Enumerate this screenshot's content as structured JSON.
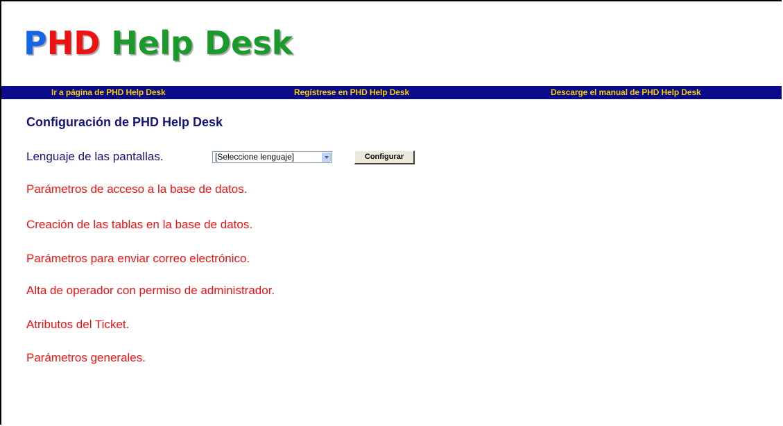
{
  "logo": {
    "p": "P",
    "hd": "HD",
    "rest": " Help Desk"
  },
  "nav": {
    "links": [
      "Ir a página de PHD Help Desk",
      "Regístrese en PHD Help Desk",
      "Descarge el manual de PHD Help Desk"
    ]
  },
  "page": {
    "title": "Configuración de PHD Help Desk"
  },
  "language": {
    "label": "Lenguaje de las pantallas.",
    "selected": "[Seleccione lenguaje]",
    "button_label": "Configurar"
  },
  "menu": {
    "items": [
      "Parámetros de acceso a la base de datos.",
      "Creación de las tablas en la base de datos.",
      "Parámetros para enviar correo electrónico.",
      "Alta de operador con permiso de administrador.",
      "Atributos del Ticket.",
      "Parámetros generales."
    ]
  },
  "colors": {
    "navbar_bg": "#0a0a8a",
    "nav_link": "#f5d000",
    "title": "#14147a",
    "menu_link": "#ee1111",
    "logo_p": "#1565e8",
    "logo_hd": "#ee1111",
    "logo_rest": "#1a9a2a"
  },
  "icons": {
    "select_arrow": "chevron-down-icon"
  }
}
